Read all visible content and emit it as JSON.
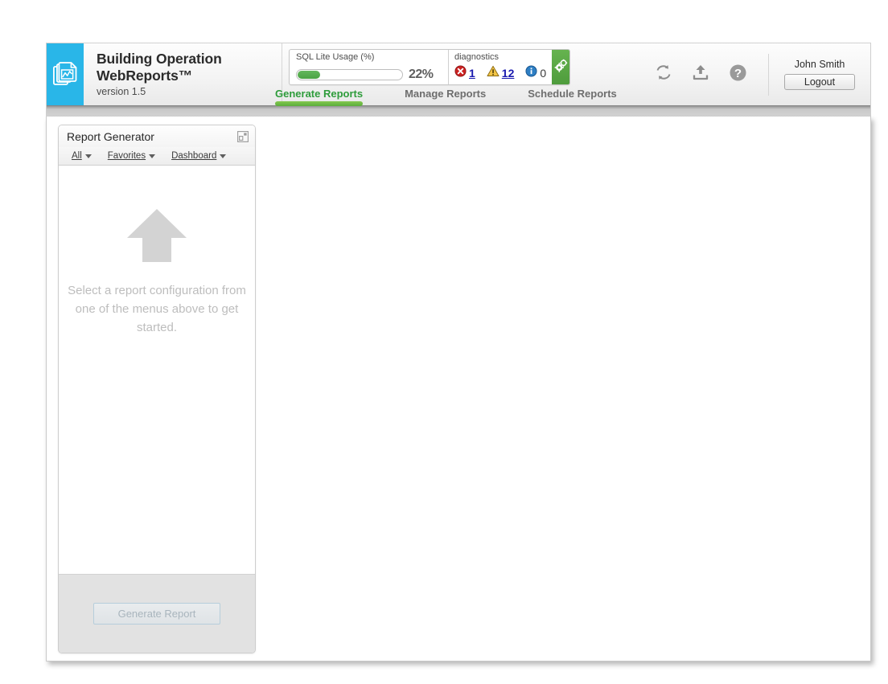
{
  "brand": {
    "line1": "Building Operation",
    "line2": "WebReports™",
    "version": "version 1.5",
    "logo_icon": "documents-chart-icon",
    "accent_color": "#29b6e8"
  },
  "status": {
    "sql": {
      "title": "SQL Lite Usage (%)",
      "percent_label": "22%",
      "percent_value": 22,
      "bar_color": "#54a845"
    },
    "diagnostics": {
      "title": "diagnostics",
      "items": [
        {
          "icon": "error-icon",
          "count": "1",
          "color": "#cc2222",
          "link": true
        },
        {
          "icon": "warning-icon",
          "count": "12",
          "color": "#e8b221",
          "link": true
        },
        {
          "icon": "info-icon",
          "count": "0",
          "color": "#2e7fc4",
          "link": false
        }
      ],
      "settings_icon": "gears-icon",
      "settings_color": "#58a643"
    }
  },
  "header_icons": [
    {
      "name": "refresh-icon"
    },
    {
      "name": "upload-icon"
    },
    {
      "name": "help-icon"
    }
  ],
  "user": {
    "name": "John Smith",
    "logout_label": "Logout"
  },
  "tabs": [
    {
      "label": "Generate Reports",
      "active": true
    },
    {
      "label": "Manage Reports",
      "active": false
    },
    {
      "label": "Schedule Reports",
      "active": false
    }
  ],
  "report_panel": {
    "title": "Report Generator",
    "layout_icon": "layout-toggle-icon",
    "menus": [
      {
        "label": "All",
        "icon": "chevron-down-icon"
      },
      {
        "label": "Favorites",
        "icon": "chevron-down-icon"
      },
      {
        "label": "Dashboard",
        "icon": "chevron-down-icon"
      }
    ],
    "empty_state": {
      "icon": "arrow-up-icon",
      "message": "Select a report configuration from one of the menus above to get started."
    },
    "generate_button": {
      "label": "Generate Report",
      "disabled": true
    }
  }
}
